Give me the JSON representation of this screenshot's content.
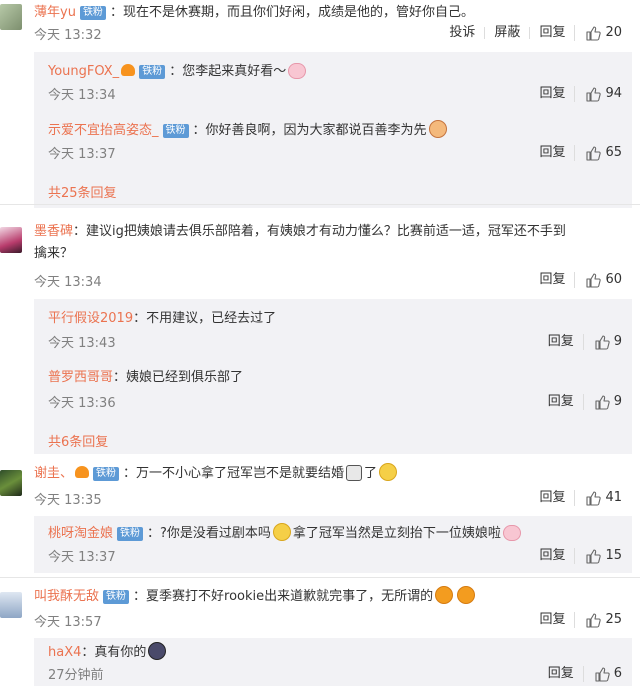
{
  "comments": [
    {
      "username": "薄年yu",
      "badge": "铁粉",
      "text": "：现在不是休赛期，而且你们好闲，成绩是他的，管好你自己。",
      "time": "今天 13:32",
      "report": "投诉",
      "block": "屏蔽",
      "reply": "回复",
      "likes": "20",
      "replies": [
        {
          "username": "YoungFOX_",
          "badge": "铁粉",
          "text": "：您李起来真好看～",
          "emoji": "pig-icon",
          "time": "今天 13:34",
          "reply": "回复",
          "likes": "94"
        },
        {
          "username": "示爱不宜抬高姿态_",
          "badge": "铁粉",
          "text": "：你好善良啊，因为大家都说百善李为先",
          "emoji": "old-man-icon",
          "time": "今天 13:37",
          "reply": "回复",
          "likes": "65"
        }
      ],
      "more": "共25条回复"
    },
    {
      "username": "墨香碑",
      "text_line1": "：建议ig把姨娘请去俱乐部陪着，有姨娘才有动力懂么？比赛前适一适，冠军还不手到",
      "text_line2": "擒来？",
      "time": "今天 13:34",
      "reply": "回复",
      "likes": "60",
      "replies": [
        {
          "username": "平行假设2019",
          "text": "：不用建议，已经去过了",
          "time": "今天 13:43",
          "reply": "回复",
          "likes": "9"
        },
        {
          "username": "普罗西哥哥",
          "text": "：姨娘已经到俱乐部了",
          "time": "今天 13:36",
          "reply": "回复",
          "likes": "9"
        }
      ],
      "more": "共6条回复"
    },
    {
      "username": "谢圭、",
      "badge": "铁粉",
      "text_a": "：万一不小心拿了冠军岂不是就要结婚",
      "text_b": "了",
      "time": "今天 13:35",
      "reply": "回复",
      "likes": "41",
      "replies": [
        {
          "username": "桃呀淘金娘",
          "badge": "铁粉",
          "text_a": "：?你是没看过剧本吗",
          "text_b": "拿了冠军当然是立刻抬下一位姨娘啦",
          "time": "今天 13:37",
          "reply": "回复",
          "likes": "15"
        }
      ]
    },
    {
      "username": "叫我酥无敌",
      "badge": "铁粉",
      "text": "：夏季赛打不好rookie出来道歉就完事了，无所谓的",
      "time": "今天 13:57",
      "reply": "回复",
      "likes": "25",
      "replies": [
        {
          "username": "haX4",
          "text": "：真有你的",
          "time": "27分钟前",
          "reply": "回复",
          "likes": "6"
        }
      ]
    }
  ],
  "colors": {
    "username": "#eb7350",
    "badge": "#5d9ad6",
    "reply_bg": "#f2f2f5"
  }
}
